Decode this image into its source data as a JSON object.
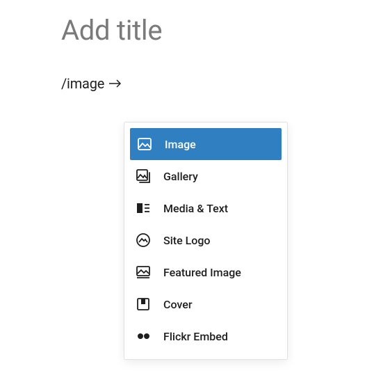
{
  "title_placeholder": "Add title",
  "slash_command": "/image",
  "popover": {
    "options": [
      {
        "label": "Image",
        "icon": "image-icon",
        "selected": true
      },
      {
        "label": "Gallery",
        "icon": "gallery-icon",
        "selected": false
      },
      {
        "label": "Media & Text",
        "icon": "media-text-icon",
        "selected": false
      },
      {
        "label": "Site Logo",
        "icon": "site-logo-icon",
        "selected": false
      },
      {
        "label": "Featured Image",
        "icon": "featured-image-icon",
        "selected": false
      },
      {
        "label": "Cover",
        "icon": "cover-icon",
        "selected": false
      },
      {
        "label": "Flickr Embed",
        "icon": "flickr-icon",
        "selected": false
      }
    ]
  },
  "colors": {
    "accent": "#2f7fc1"
  }
}
